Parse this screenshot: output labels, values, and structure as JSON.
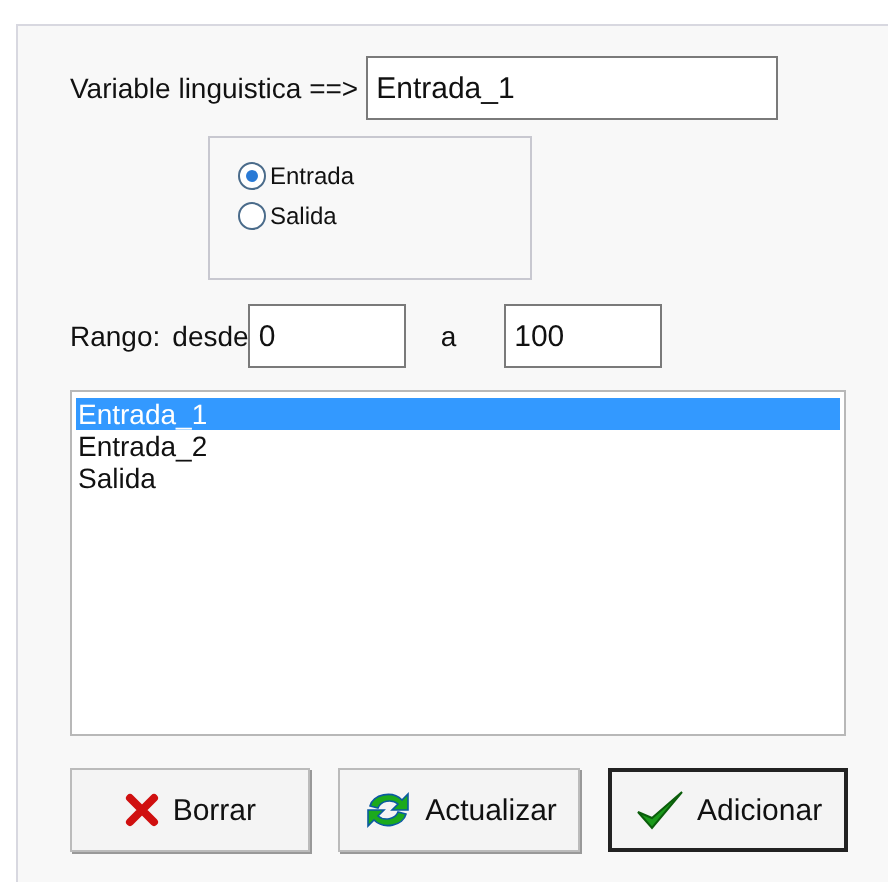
{
  "variable": {
    "label": "Variable linguistica ==>",
    "value": "Entrada_1"
  },
  "type_options": [
    {
      "label": "Entrada",
      "selected": true
    },
    {
      "label": "Salida",
      "selected": false
    }
  ],
  "range": {
    "label": "Rango:",
    "from_label": "desde",
    "from": "0",
    "to_label": "a",
    "to": "100"
  },
  "list": [
    {
      "label": "Entrada_1",
      "selected": true
    },
    {
      "label": "Entrada_2",
      "selected": false
    },
    {
      "label": "Salida",
      "selected": false
    }
  ],
  "buttons": [
    {
      "label": "Borrar",
      "kind": "delete",
      "default": false
    },
    {
      "label": "Actualizar",
      "kind": "refresh",
      "default": false
    },
    {
      "label": "Adicionar",
      "kind": "add",
      "default": true
    }
  ]
}
